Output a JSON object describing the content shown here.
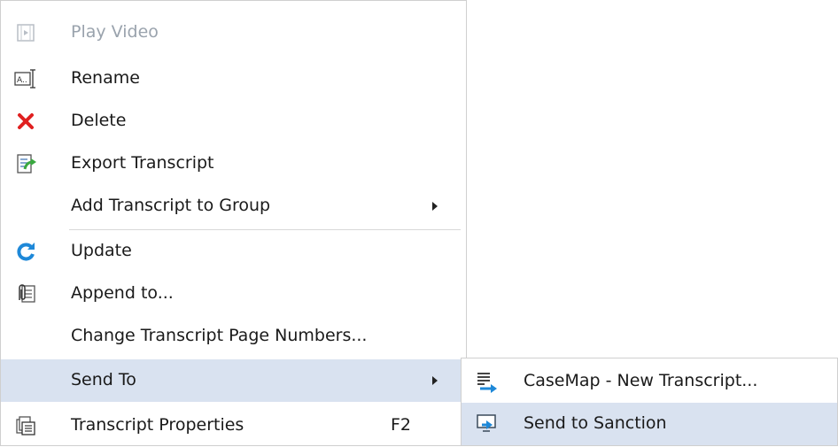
{
  "menu": {
    "items": [
      {
        "label": "Play Video",
        "icon": "play-video-icon",
        "disabled": true
      },
      {
        "label": "Rename",
        "icon": "rename-icon"
      },
      {
        "label": "Delete",
        "icon": "delete-icon"
      },
      {
        "label": "Export Transcript",
        "icon": "export-transcript-icon"
      },
      {
        "label": "Add Transcript to Group",
        "has_submenu": true
      },
      {
        "label": "Update",
        "icon": "update-icon"
      },
      {
        "label": "Append to...",
        "icon": "append-icon"
      },
      {
        "label": "Change Transcript Page Numbers..."
      },
      {
        "label": "Send To",
        "has_submenu": true,
        "highlighted": true
      },
      {
        "label": "Transcript Properties",
        "icon": "properties-icon",
        "shortcut": "F2"
      }
    ]
  },
  "submenu": {
    "items": [
      {
        "label": "CaseMap - New Transcript...",
        "icon": "casemap-icon"
      },
      {
        "label": "Send to Sanction",
        "icon": "send-to-sanction-icon",
        "highlighted": true
      }
    ]
  },
  "colors": {
    "highlight": "#d9e2f0",
    "delete_red": "#e02020",
    "update_blue": "#1e88d8",
    "export_green": "#3aa840",
    "disabled_text": "#9aa3ad"
  }
}
